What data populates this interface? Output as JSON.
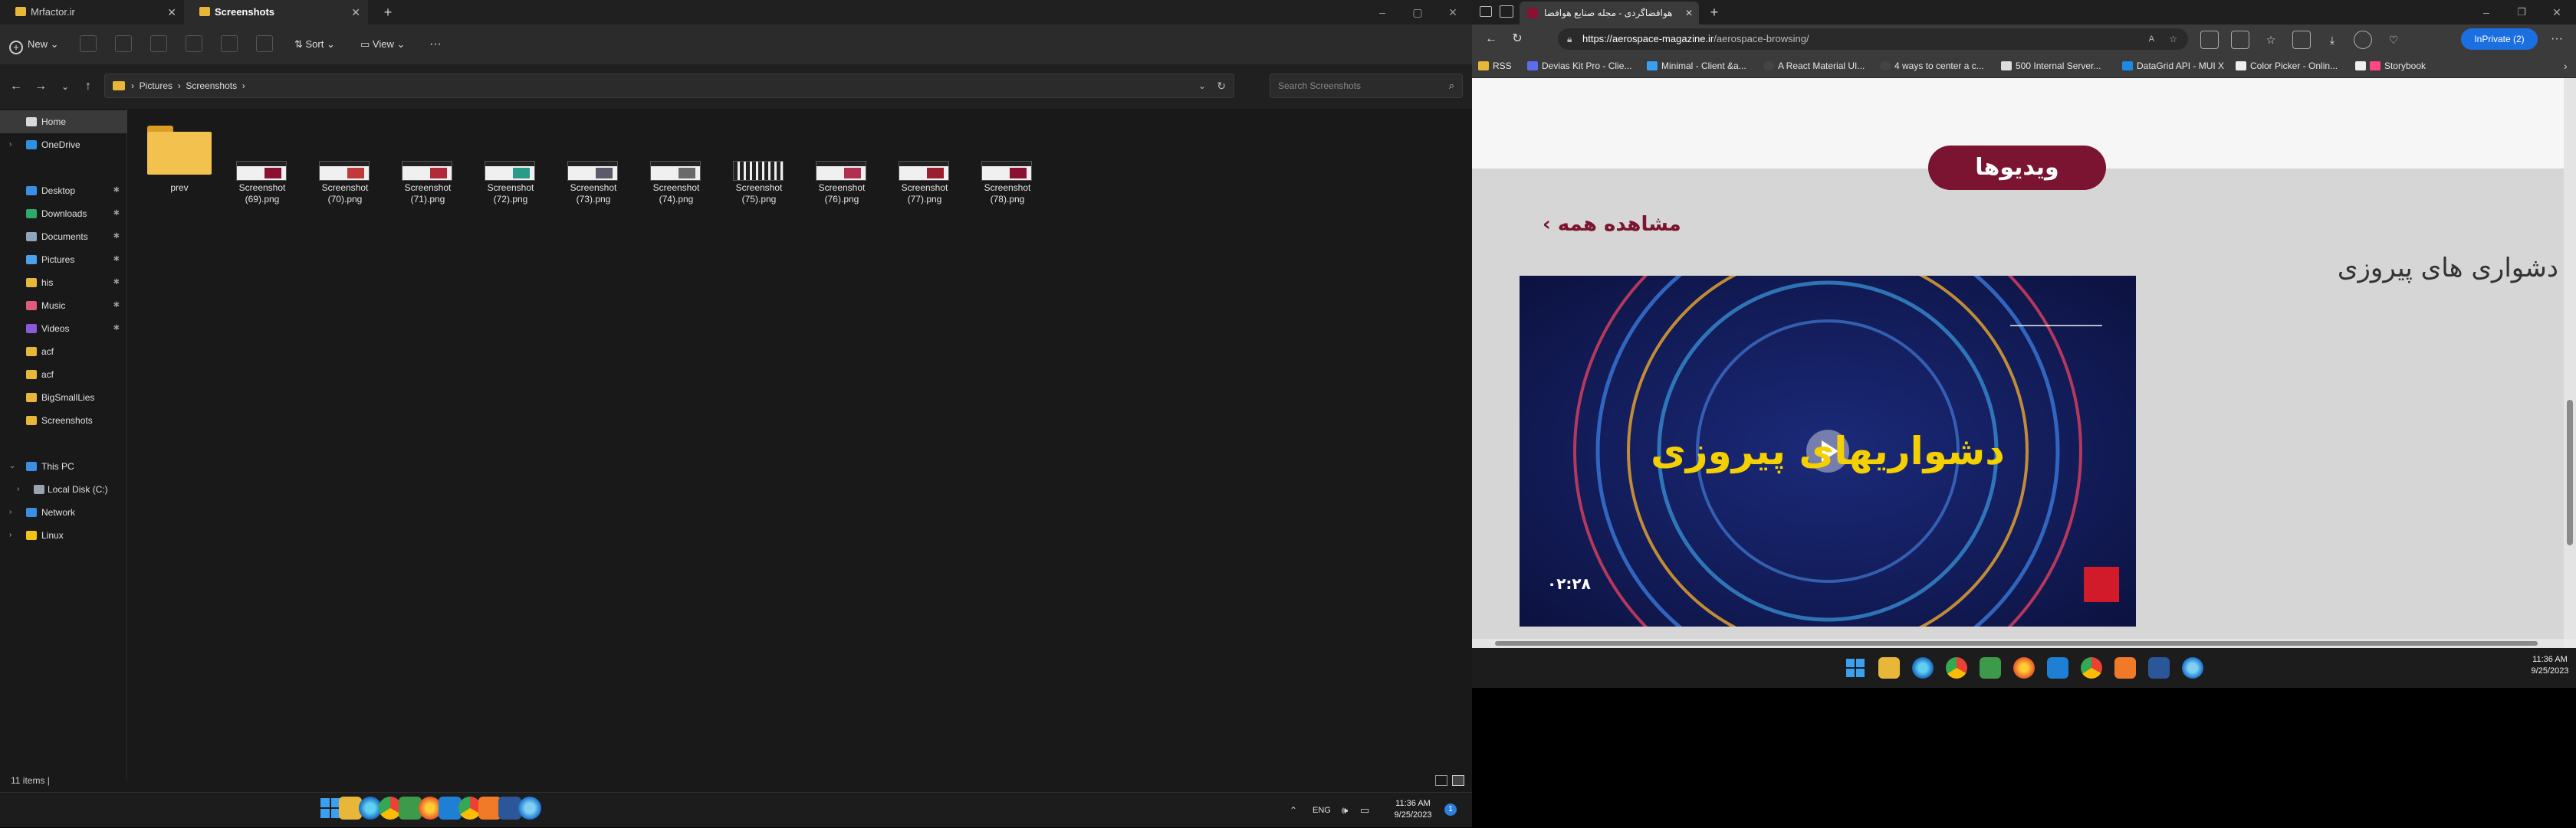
{
  "explorer": {
    "tabs": [
      {
        "label": "Mrfactor.ir"
      },
      {
        "label": "Screenshots"
      }
    ],
    "toolbar": {
      "new_label": "New",
      "sort_label": "Sort",
      "view_label": "View",
      "more_label": "···"
    },
    "breadcrumb": [
      "Pictures",
      "Screenshots"
    ],
    "search_placeholder": "Search Screenshots",
    "sidebar": [
      {
        "label": "Home",
        "icon": "home-icon",
        "selected": true
      },
      {
        "label": "OneDrive",
        "icon": "cloud-icon"
      },
      {
        "label": "Desktop",
        "icon": "desktop-icon",
        "pinned": true
      },
      {
        "label": "Downloads",
        "icon": "download-icon",
        "pinned": true
      },
      {
        "label": "Documents",
        "icon": "document-icon",
        "pinned": true
      },
      {
        "label": "Pictures",
        "icon": "pictures-icon",
        "pinned": true
      },
      {
        "label": "his",
        "icon": "folder-icon",
        "pinned": true
      },
      {
        "label": "Music",
        "icon": "music-icon",
        "pinned": true
      },
      {
        "label": "Videos",
        "icon": "video-icon",
        "pinned": true
      },
      {
        "label": "acf",
        "icon": "folder-icon"
      },
      {
        "label": "acf",
        "icon": "folder-icon"
      },
      {
        "label": "BigSmallLies",
        "icon": "folder-icon"
      },
      {
        "label": "Screenshots",
        "icon": "folder-icon"
      },
      {
        "label": "This PC",
        "icon": "pc-icon"
      },
      {
        "label": "Local Disk (C:)",
        "icon": "disk-icon"
      },
      {
        "label": "Network",
        "icon": "network-icon"
      },
      {
        "label": "Linux",
        "icon": "linux-icon"
      }
    ],
    "files": [
      {
        "label": "prev",
        "type": "folder"
      },
      {
        "label": "Screenshot\n(69).png",
        "type": "image"
      },
      {
        "label": "Screenshot\n(70).png",
        "type": "image"
      },
      {
        "label": "Screenshot\n(71).png",
        "type": "image"
      },
      {
        "label": "Screenshot\n(72).png",
        "type": "image"
      },
      {
        "label": "Screenshot\n(73).png",
        "type": "image"
      },
      {
        "label": "Screenshot\n(74).png",
        "type": "image"
      },
      {
        "label": "Screenshot\n(75).png",
        "type": "image"
      },
      {
        "label": "Screenshot\n(76).png",
        "type": "image"
      },
      {
        "label": "Screenshot\n(77).png",
        "type": "image"
      },
      {
        "label": "Screenshot\n(78).png",
        "type": "image"
      }
    ],
    "status": "11 items  |"
  },
  "taskbar_left": {
    "lang": "ENG",
    "time": "11:36 AM",
    "date": "9/25/2023",
    "notif_count": "1"
  },
  "browser": {
    "tab_title": "هوافضاگردی - مجله صنایع هوافضا",
    "url_domain": "https://aerospace-magazine.ir",
    "url_path": "/aerospace-browsing/",
    "inprivate_label": "InPrivate (2)",
    "bookmarks": [
      "RSS",
      "Devias Kit Pro - Clie...",
      "Minimal - Client &a...",
      "A React Material UI...",
      "4 ways to center a c...",
      "500 Internal Server...",
      "DataGrid API - MUI X",
      "Color Picker - Onlin...",
      "Storybook"
    ],
    "page": {
      "videos_button": "ویدیوها",
      "see_all": "مشاهده همه",
      "video_title": "دشواری های پیروزی",
      "video_overlay_title": "دشواریهای پیروزی",
      "video_duration": "۰۲:۲۸",
      "brand_color": "#7a1430"
    }
  },
  "taskbar_right": {
    "time": "11:36 AM",
    "date": "9/25/2023"
  }
}
